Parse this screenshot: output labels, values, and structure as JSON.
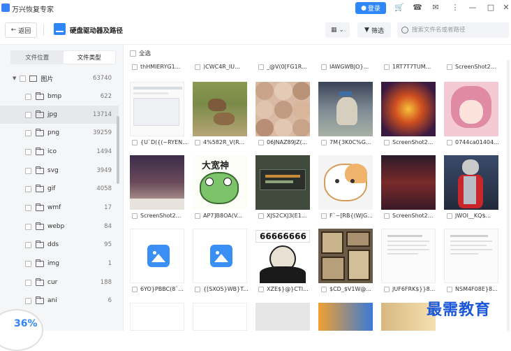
{
  "app": {
    "title": "万兴恢复专家",
    "login_label": "登录"
  },
  "nav": {
    "back_label": "返回",
    "title": "硬盘驱动器及路径",
    "filter_label": "筛选",
    "search_placeholder": "搜索文件名或者路径"
  },
  "sidebar": {
    "tabs": [
      {
        "label": "文件位置"
      },
      {
        "label": "文件类型"
      }
    ],
    "active_tab": "文件类型",
    "root": {
      "label": "图片",
      "count": "63740"
    },
    "items": [
      {
        "label": "bmp",
        "count": "622"
      },
      {
        "label": "jpg",
        "count": "13714"
      },
      {
        "label": "png",
        "count": "39259"
      },
      {
        "label": "ico",
        "count": "1494"
      },
      {
        "label": "svg",
        "count": "3949"
      },
      {
        "label": "gif",
        "count": "4058"
      },
      {
        "label": "wmf",
        "count": "17"
      },
      {
        "label": "webp",
        "count": "84"
      },
      {
        "label": "dds",
        "count": "95"
      },
      {
        "label": "img",
        "count": "1"
      },
      {
        "label": "cur",
        "count": "188"
      },
      {
        "label": "ani",
        "count": "6"
      }
    ],
    "progress": "36%"
  },
  "main": {
    "select_all_label": "全选",
    "top_row": [
      "thHMIERYG1...",
      ")CWC4R_IU...",
      "_@V(0[FG1R...",
      "IAWGWBJO}...",
      "1RT7T7TUM...",
      "ScreenShot2..."
    ],
    "row1": [
      "{U`D({(~RYEN...",
      "4%582R_V(R...",
      "06JNAZ89JZ(...",
      "7M{3K0C%G...",
      "ScreenShot2...",
      "0744ca01404..."
    ],
    "row2": [
      "ScreenShot2...",
      "AP7]B8OA(V...",
      "XJS2CXJ3(E1...",
      "F`~[RB{(WJG...",
      "ScreenShot2...",
      "JWOI__KQ$..."
    ],
    "row3": [
      "6YO}PBBC(8`...",
      "{[SXO5}WB}T...",
      "XZE$}@}CTI...",
      "$CD_$V1W@...",
      "JUF6FRK$}}8...",
      "NSM4F08E}8..."
    ],
    "meme_text": "66666666",
    "meme_title": "大宽神"
  },
  "watermark": "最需教育"
}
